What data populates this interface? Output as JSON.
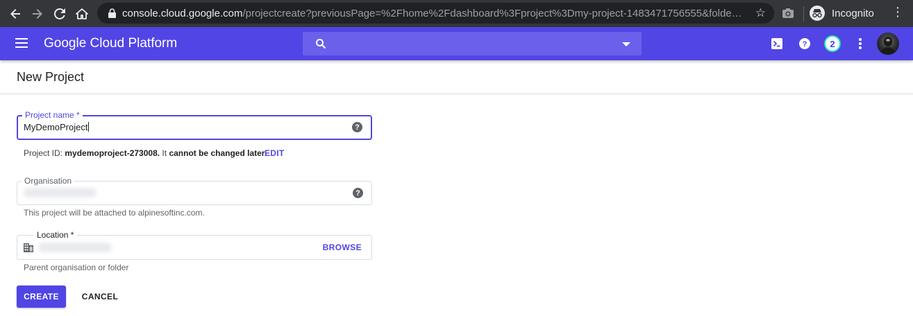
{
  "browser": {
    "url_host": "console.cloud.google.com",
    "url_path": "/projectcreate?previousPage=%2Fhome%2Fdashboard%3Fproject%3Dmy-project-1483471756555&folder=&orga...",
    "profile_label": "Incognito",
    "icons": [
      "back-arrow-icon",
      "forward-arrow-icon",
      "reload-icon",
      "home-icon",
      "lock-icon",
      "star-icon",
      "camera-icon",
      "incognito-icon",
      "more-vert-icon"
    ]
  },
  "header": {
    "brand": "Google Cloud Platform",
    "search_placeholder": "",
    "notification_count": "2",
    "accent_color": "#5145e5",
    "icons": [
      "menu-icon",
      "search-icon",
      "cloud-shell-icon",
      "help-icon",
      "more-vert-icon"
    ]
  },
  "page": {
    "title": "New Project"
  },
  "form": {
    "project_name": {
      "label": "Project name *",
      "value": "MyDemoProject"
    },
    "project_id": {
      "prefix": "Project ID: ",
      "id": "mydemoproject-273008.",
      "middle": " It ",
      "note": "cannot be changed later.",
      "edit_label": "EDIT"
    },
    "organisation": {
      "label": "Organisation",
      "helper": "This project will be attached to alpinesoftinc.com."
    },
    "location": {
      "label": "Location *",
      "browse_label": "BROWSE",
      "helper": "Parent organisation or folder"
    },
    "create_label": "CREATE",
    "cancel_label": "CANCEL"
  }
}
